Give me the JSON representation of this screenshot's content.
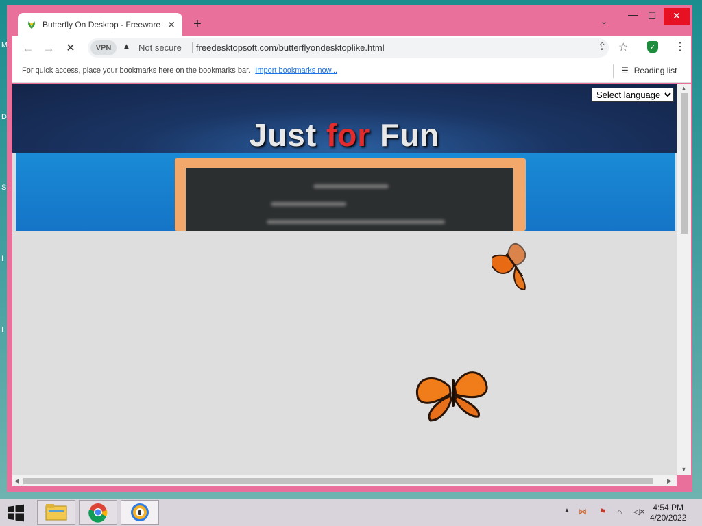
{
  "tab": {
    "title": "Butterfly On Desktop - Freeware",
    "close": "✕",
    "new_tab": "+"
  },
  "toolbar": {
    "back": "←",
    "forward": "→",
    "reload": "✕",
    "vpn": "VPN",
    "security": "Not secure",
    "url": "freedesktopsoft.com/butterflyondesktoplike.html"
  },
  "bookmarks": {
    "prompt": "For quick access, place your bookmarks here on the bookmarks bar.",
    "import": "Import bookmarks now...",
    "reading_list": "Reading list"
  },
  "page": {
    "banner_part1": "Just ",
    "banner_part2": "for",
    "banner_part3": " Fun",
    "language_selected": "Select language"
  },
  "desktop_labels": [
    "M",
    "D",
    "S",
    "I",
    "I"
  ],
  "clock": {
    "time": "4:54 PM",
    "date": "4/20/2022"
  },
  "colors": {
    "window_frame": "#e8709a",
    "banner_accent": "#e32b2b",
    "board": "#f1a86a"
  }
}
